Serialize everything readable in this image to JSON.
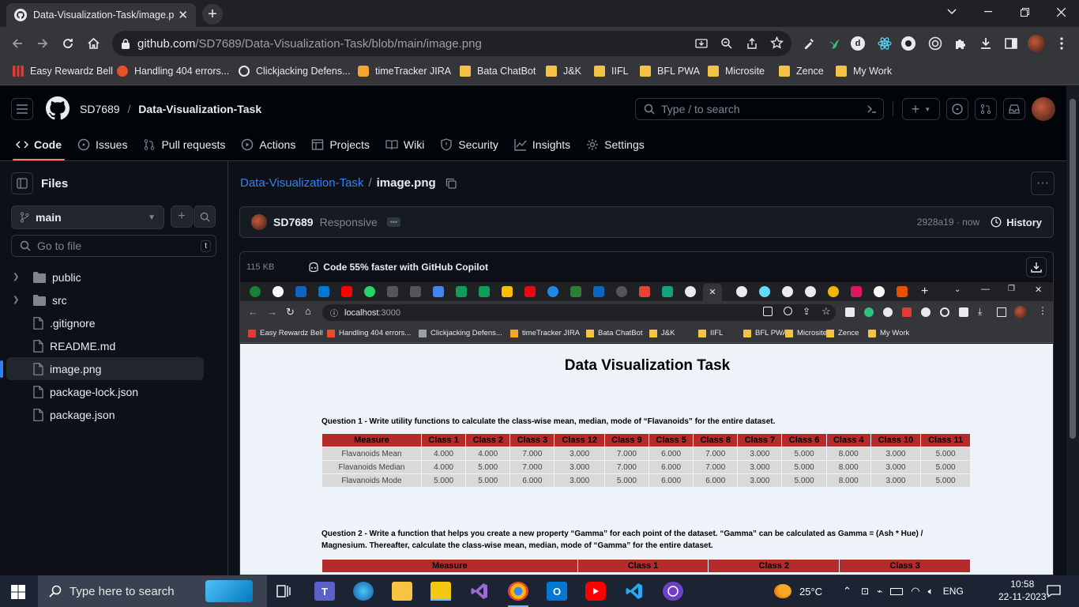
{
  "browser": {
    "tab_title": "Data-Visualization-Task/image.p",
    "url_host": "github.com",
    "url_path": "/SD7689/Data-Visualization-Task/blob/main/image.png",
    "bookmarks": [
      "Easy Rewardz Bell",
      "Handling 404 errors...",
      "Clickjacking Defens...",
      "timeTracker JIRA",
      "Bata ChatBot",
      "J&K",
      "IIFL",
      "BFL PWA",
      "Microsite",
      "Zence",
      "My Work"
    ]
  },
  "github": {
    "owner": "SD7689",
    "repo": "Data-Visualization-Task",
    "search_placeholder": "Type / to search",
    "nav": [
      "Code",
      "Issues",
      "Pull requests",
      "Actions",
      "Projects",
      "Wiki",
      "Security",
      "Insights",
      "Settings"
    ],
    "sidebar": {
      "title": "Files",
      "branch": "main",
      "goto_placeholder": "Go to file",
      "goto_kbd": "t",
      "tree": [
        {
          "name": "public",
          "type": "folder"
        },
        {
          "name": "src",
          "type": "folder"
        },
        {
          "name": ".gitignore",
          "type": "file"
        },
        {
          "name": "README.md",
          "type": "file"
        },
        {
          "name": "image.png",
          "type": "file",
          "selected": true
        },
        {
          "name": "package-lock.json",
          "type": "file"
        },
        {
          "name": "package.json",
          "type": "file"
        }
      ]
    },
    "path_repo": "Data-Visualization-Task",
    "path_sep": "/",
    "path_file": "image.png",
    "commit": {
      "author": "SD7689",
      "message": "Responsive",
      "hash_time": "2928a19 · now",
      "history": "History"
    },
    "viewer": {
      "size": "115  KB",
      "copilot": "Code 55% faster with GitHub Copilot"
    }
  },
  "screenshot": {
    "url_host": "localhost",
    "url_port": ":3000",
    "bookmarks": [
      "Easy Rewardz Bell",
      "Handling 404 errors...",
      "Clickjacking Defens...",
      "timeTracker JIRA",
      "Bata ChatBot",
      "J&K",
      "IIFL",
      "BFL PWA",
      "Microsite",
      "Zence",
      "My Work"
    ],
    "page_title": "Data Visualization Task",
    "q1": "Question 1 - Write utility functions to calculate the class-wise mean, median, mode of “Flavanoids” for the entire dataset.",
    "table1": {
      "headers": [
        "Measure",
        "Class 1",
        "Class 2",
        "Class 3",
        "Class 12",
        "Class 9",
        "Class 5",
        "Class 8",
        "Class 7",
        "Class 6",
        "Class 4",
        "Class 10",
        "Class 11"
      ],
      "rows": [
        [
          "Flavanoids Mean",
          "4.000",
          "4.000",
          "7.000",
          "3.000",
          "7.000",
          "6.000",
          "7.000",
          "3.000",
          "5.000",
          "8.000",
          "3.000",
          "5.000"
        ],
        [
          "Flavanoids Median",
          "4.000",
          "5.000",
          "7.000",
          "3.000",
          "7.000",
          "6.000",
          "7.000",
          "3.000",
          "5.000",
          "8.000",
          "3.000",
          "5.000"
        ],
        [
          "Flavanoids Mode",
          "5.000",
          "5.000",
          "6.000",
          "3.000",
          "5.000",
          "6.000",
          "6.000",
          "3.000",
          "5.000",
          "8.000",
          "3.000",
          "5.000"
        ]
      ]
    },
    "q2": "Question 2 - Write a function that helps you create a new property “Gamma” for each point of the dataset. “Gamma” can be calculated as Gamma = (Ash * Hue) / Magnesium. Thereafter, calculate the class-wise mean, median, mode of “Gamma” for the entire dataset.",
    "table2_headers": [
      "Measure",
      "Class 1",
      "Class 2",
      "Class 3"
    ]
  },
  "taskbar": {
    "search_placeholder": "Type here to search",
    "weather": "25°C",
    "lang": "ENG",
    "time": "10:58",
    "date": "22-11-2023"
  }
}
